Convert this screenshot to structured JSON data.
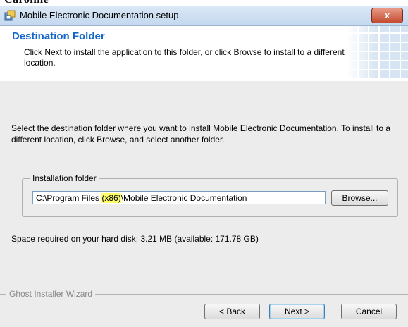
{
  "window": {
    "background_title": "Caroline",
    "title": "Mobile Electronic Documentation setup",
    "close_label": "x"
  },
  "header": {
    "title": "Destination Folder",
    "description": "Click Next to install the application to this folder, or click Browse to install to a different location."
  },
  "body": {
    "instructions": "Select the destination folder where you want to install Mobile Electronic Documentation. To install to a different location, click Browse, and select another folder.",
    "group_label": "Installation folder",
    "path": {
      "before": "C:\\Program Files ",
      "highlighted": "(x86)",
      "after": "\\Mobile Electronic Documentation"
    },
    "browse_label": "Browse...",
    "space_required": "Space required on your hard disk: 3.21 MB  (available: 171.78 GB)"
  },
  "footer": {
    "brand": "Ghost Installer Wizard",
    "back_label": "< Back",
    "next_label": "Next >",
    "cancel_label": "Cancel"
  },
  "colors": {
    "accent": "#1466c8",
    "highlight": "#ffff66",
    "close": "#c44b2f"
  }
}
